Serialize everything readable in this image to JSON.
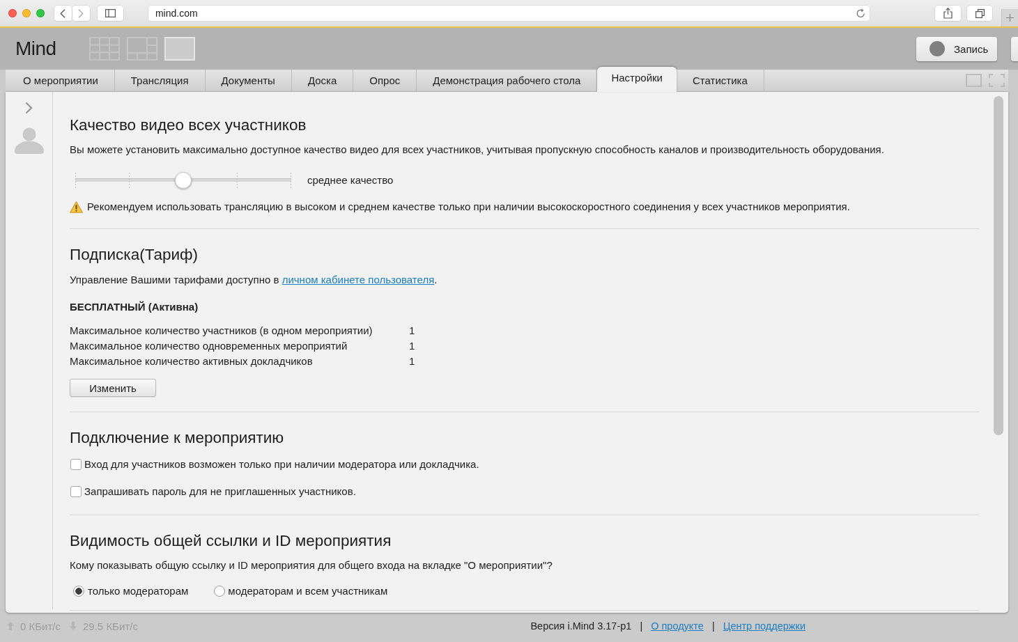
{
  "browser": {
    "address": "mind.com"
  },
  "header": {
    "logo": "Mind",
    "layouts": [
      {
        "kind": "grid",
        "selected": false
      },
      {
        "kind": "split",
        "selected": false
      },
      {
        "kind": "single",
        "selected": true
      }
    ],
    "record_button": "Запись"
  },
  "tabs": [
    {
      "label": "О мероприятии",
      "selected": false
    },
    {
      "label": "Трансляция",
      "selected": false
    },
    {
      "label": "Документы",
      "selected": false
    },
    {
      "label": "Доска",
      "selected": false
    },
    {
      "label": "Опрос",
      "selected": false
    },
    {
      "label": "Демонстрация рабочего стола",
      "selected": false
    },
    {
      "label": "Настройки",
      "selected": true
    },
    {
      "label": "Статистика",
      "selected": false
    }
  ],
  "sections": [
    {
      "kind": "quality",
      "title": "Качество видео всех участников",
      "description": "Вы можете установить максимально доступное качество видео для всех участников, учитывая пропускную способность каналов и производительность оборудования.",
      "slider": {
        "level": 0.5,
        "reading": "среднее качество"
      },
      "warning": "Рекомендуем использовать трансляцию в высоком и среднем качестве только при наличии высокоскоростного соединения у всех участников мероприятия."
    },
    {
      "kind": "subscription",
      "title": "Подписка(Тариф)",
      "description": {
        "text": "Управление Вашими тарифами доступно в",
        "link": "личном кабинете пользователя",
        "end": "."
      },
      "plan": "БЕСПЛАТНЫЙ (Активна)",
      "limits": [
        {
          "label": "Максимальное количество участников (в одном мероприятии)",
          "value": "1"
        },
        {
          "label": "Максимальное количество одновременных мероприятий",
          "value": "1"
        },
        {
          "label": "Максимальное количество активных докладчиков",
          "value": "1"
        }
      ],
      "button": "Изменить"
    },
    {
      "kind": "checkboxes",
      "title": "Подключение к мероприятию",
      "options": [
        {
          "label": "Вход для участников возможен только при наличии модератора или докладчика.",
          "checked": false
        },
        {
          "label": "Запрашивать пароль для не приглашенных участников.",
          "checked": false
        }
      ]
    },
    {
      "kind": "radios",
      "title": "Видимость общей ссылки и ID мероприятия",
      "question": "Кому показывать общую ссылку и ID мероприятия для общего входа на вкладке \"О мероприятии\"?",
      "options": [
        {
          "label": "только модераторам",
          "selected": true
        },
        {
          "label": "модераторам и всем участникам",
          "selected": false
        }
      ]
    }
  ],
  "status_bar": {
    "upload": "0 КБит/с",
    "download": "29.5 КБит/с",
    "items": [
      {
        "kind": "text",
        "label": "Версия i.Mind 3.17-p1"
      },
      {
        "kind": "separator",
        "label": "|"
      },
      {
        "kind": "link",
        "label": "О продукте"
      },
      {
        "kind": "separator",
        "label": "|"
      },
      {
        "kind": "link",
        "label": "Центр поддержки"
      }
    ]
  }
}
